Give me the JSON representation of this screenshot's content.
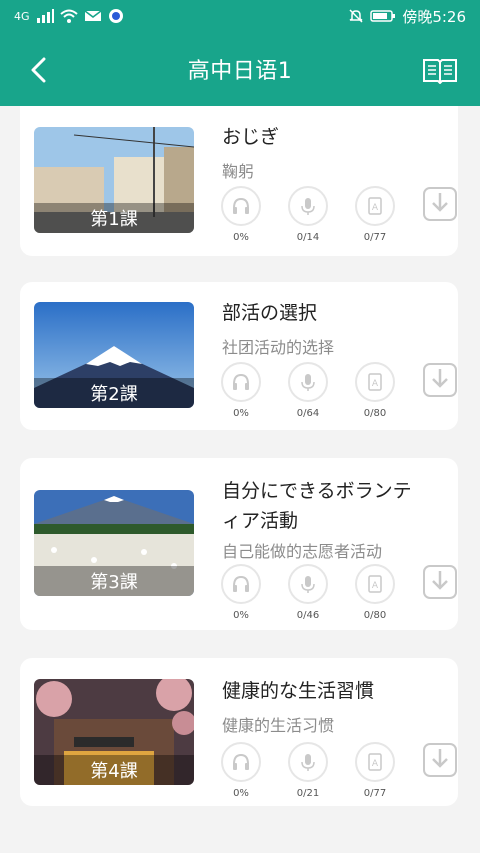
{
  "status_bar": {
    "left": "4G",
    "right_time": "傍晚5:26"
  },
  "header": {
    "title": "高中日语1"
  },
  "icons": {
    "back": "back-icon",
    "book": "book-icon",
    "headphones": "headphones-icon",
    "mic": "mic-icon",
    "doc": "document-icon",
    "download": "download-icon"
  },
  "colors": {
    "primary": "#18a58b",
    "card": "#ffffff",
    "bg": "#f3f3f3",
    "muted": "#8c8c8c"
  },
  "lessons": [
    {
      "label": "第1課",
      "title": "おじぎ",
      "subtitle": "鞠躬",
      "listen": "0%",
      "speak": "0/14",
      "docs": "0/77"
    },
    {
      "label": "第2課",
      "title": "部活の選択",
      "subtitle": "社团活动的选择",
      "listen": "0%",
      "speak": "0/64",
      "docs": "0/80"
    },
    {
      "label": "第3課",
      "title": "自分にできるボランティア活動",
      "subtitle": "自己能做的志愿者活动",
      "listen": "0%",
      "speak": "0/46",
      "docs": "0/80"
    },
    {
      "label": "第4課",
      "title": "健康的な生活習慣",
      "subtitle": "健康的生活习惯",
      "listen": "0%",
      "speak": "0/21",
      "docs": "0/77"
    }
  ]
}
